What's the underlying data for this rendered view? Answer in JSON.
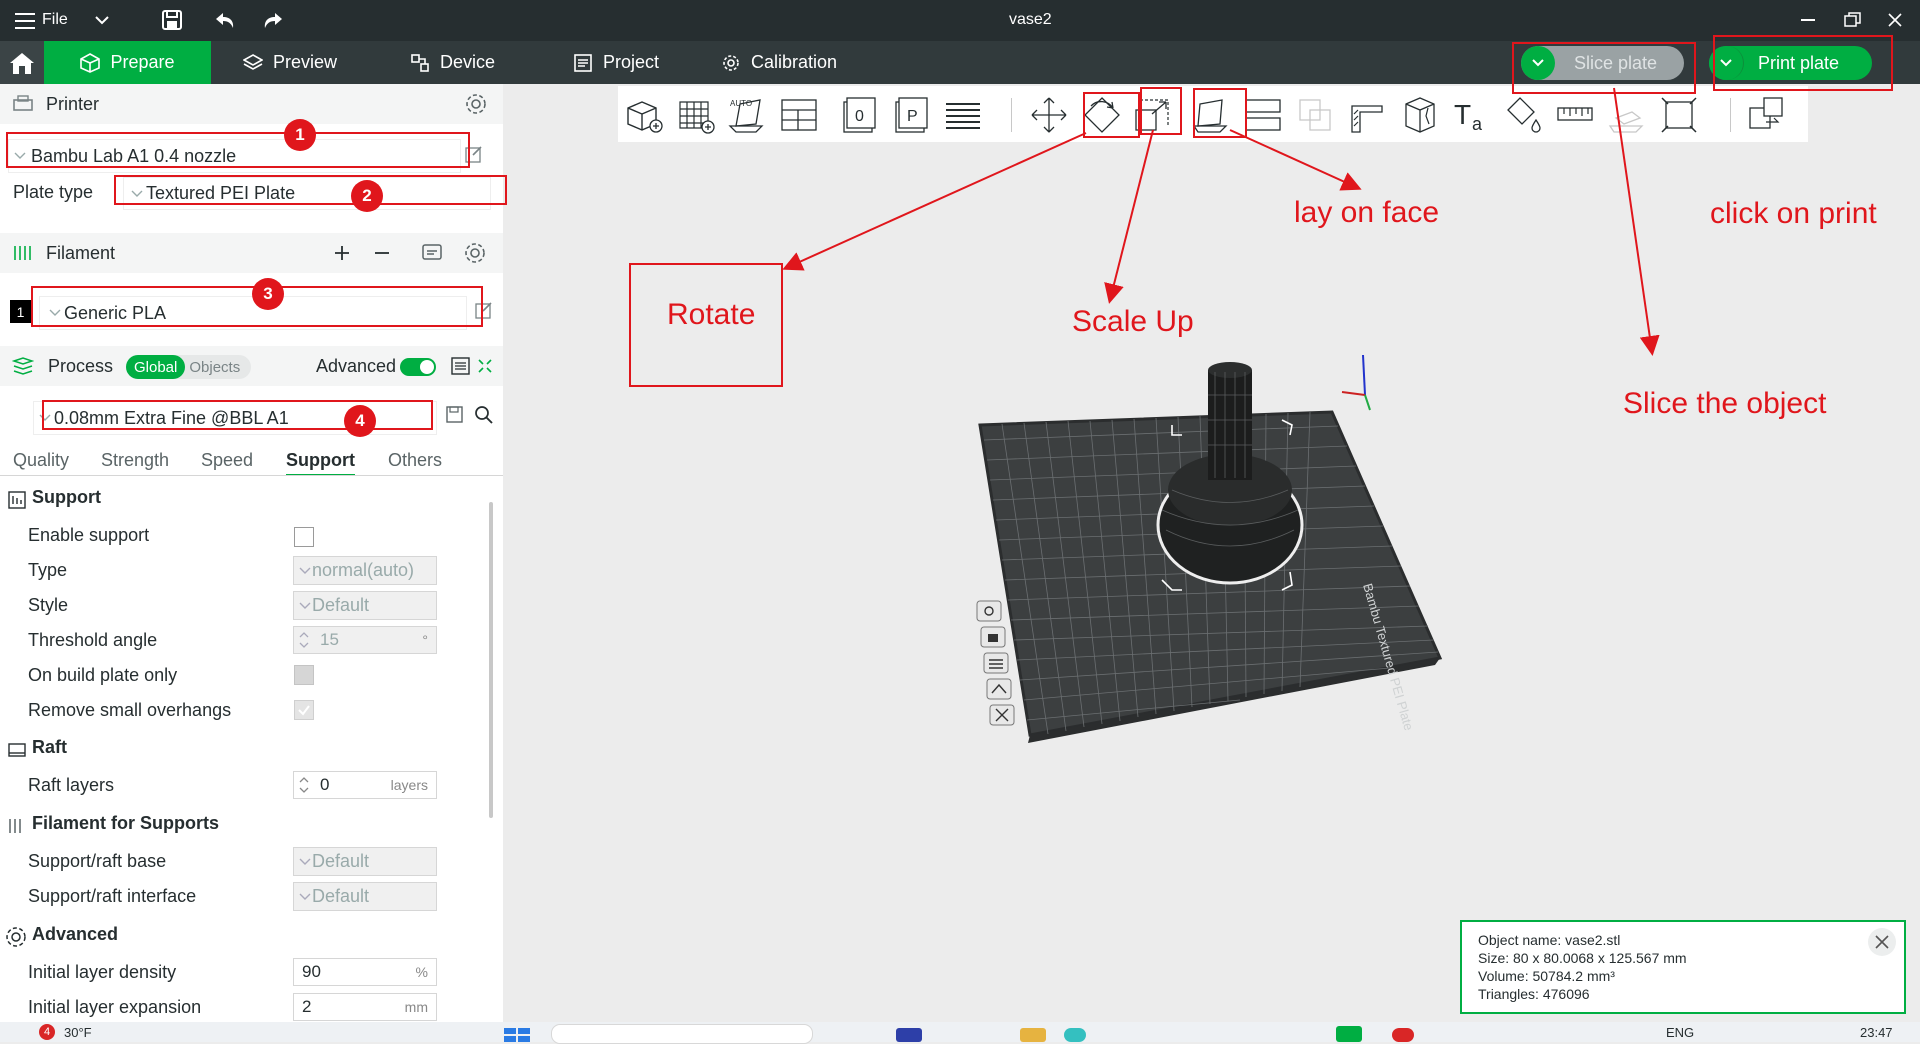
{
  "window": {
    "title": "vase2",
    "file_menu": "File"
  },
  "nav": {
    "tabs": [
      {
        "label": "Prepare"
      },
      {
        "label": "Preview"
      },
      {
        "label": "Device"
      },
      {
        "label": "Project"
      },
      {
        "label": "Calibration"
      }
    ],
    "slice_button": "Slice plate",
    "print_button": "Print plate"
  },
  "printer": {
    "section_title": "Printer",
    "selected": "Bambu Lab A1 0.4 nozzle",
    "plate_type_label": "Plate type",
    "plate_type": "Textured PEI Plate"
  },
  "filament": {
    "section_title": "Filament",
    "slot_number": "1",
    "selected": "Generic PLA"
  },
  "process": {
    "section_title": "Process",
    "toggle_global": "Global",
    "toggle_objects": "Objects",
    "advanced_label": "Advanced",
    "advanced_on": true,
    "preset": "0.08mm Extra Fine @BBL A1",
    "subtabs": [
      "Quality",
      "Strength",
      "Speed",
      "Support",
      "Others"
    ],
    "active_subtab": "Support"
  },
  "settings": {
    "support_group": "Support",
    "enable_support": "Enable support",
    "type_label": "Type",
    "type_value": "normal(auto)",
    "style_label": "Style",
    "style_value": "Default",
    "threshold_label": "Threshold angle",
    "threshold_value": "15",
    "threshold_unit": "°",
    "build_plate_only": "On build plate only",
    "remove_overhangs": "Remove small overhangs",
    "raft_group": "Raft",
    "raft_layers_label": "Raft layers",
    "raft_layers_value": "0",
    "raft_layers_unit": "layers",
    "filament_supports_group": "Filament for Supports",
    "raft_base_label": "Support/raft base",
    "raft_base_value": "Default",
    "raft_interface_label": "Support/raft interface",
    "raft_interface_value": "Default",
    "advanced_group": "Advanced",
    "initial_density_label": "Initial layer density",
    "initial_density_value": "90",
    "initial_density_unit": "%",
    "initial_expansion_label": "Initial layer expansion",
    "initial_expansion_value": "2",
    "initial_expansion_unit": "mm"
  },
  "annotations": {
    "num1": "1",
    "num2": "2",
    "num3": "3",
    "num4": "4",
    "rotate": "Rotate",
    "scale_up": "Scale Up",
    "lay_on_face": "lay on face",
    "click_on_print": "click on print",
    "slice_the_object": "Slice the object"
  },
  "object_info": {
    "name": "Object name: vase2.stl",
    "size": "Size: 80 x 80.0068 x 125.567 mm",
    "volume": "Volume: 50784.2 mm³",
    "triangles": "Triangles: 476096"
  },
  "plate_label": "Bambu Textured PEI Plate",
  "taskbar": {
    "notification_count": "4",
    "weather": "30°F",
    "language": "ENG",
    "time": "23:47"
  },
  "colors": {
    "accent_green": "#00ae42",
    "title_bar": "#262e30",
    "nav_bar": "#313a3c",
    "annotation_red": "#e0161c"
  }
}
